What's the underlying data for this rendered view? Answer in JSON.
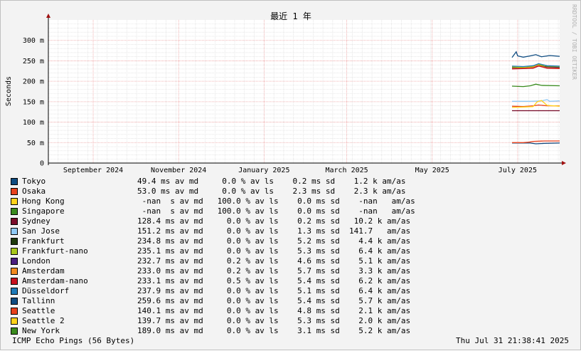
{
  "chart_data": {
    "type": "line",
    "title": "最近 1 年",
    "ylabel": "Seconds",
    "ylim": [
      0,
      0.35
    ],
    "y_ticks": [
      {
        "value": 0,
        "label": "0"
      },
      {
        "value": 0.05,
        "label": "50 m"
      },
      {
        "value": 0.1,
        "label": "100 m"
      },
      {
        "value": 0.15,
        "label": "150 m"
      },
      {
        "value": 0.2,
        "label": "200 m"
      },
      {
        "value": 0.25,
        "label": "250 m"
      },
      {
        "value": 0.3,
        "label": "300 m"
      }
    ],
    "xlim": [
      "2024-07-31",
      "2025-07-31"
    ],
    "x_ticks": [
      {
        "date": "2024-09-01",
        "label": "September 2024"
      },
      {
        "date": "2024-11-01",
        "label": "November 2024"
      },
      {
        "date": "2025-01-01",
        "label": "January 2025"
      },
      {
        "date": "2025-03-01",
        "label": "March 2025"
      },
      {
        "date": "2025-05-01",
        "label": "May 2025"
      },
      {
        "date": "2025-07-01",
        "label": "July 2025"
      }
    ],
    "grid": true,
    "series": [
      {
        "name": "Tokyo",
        "color": "#0f4c81",
        "stats": "49.4 ms av md     0.0 % av ls    0.2 ms sd    1.2 k am/as",
        "points": [
          [
            "2025-06-27",
            0.049
          ],
          [
            "2025-07-05",
            0.049
          ],
          [
            "2025-07-10",
            0.049
          ],
          [
            "2025-07-14",
            0.047
          ],
          [
            "2025-07-20",
            0.048
          ],
          [
            "2025-07-31",
            0.049
          ]
        ]
      },
      {
        "name": "Osaka",
        "color": "#e8411c",
        "stats": "53.0 ms av md     0.0 % av ls    2.3 ms sd    2.3 k am/as",
        "points": [
          [
            "2025-06-27",
            0.05
          ],
          [
            "2025-07-05",
            0.05
          ],
          [
            "2025-07-09",
            0.051
          ],
          [
            "2025-07-12",
            0.053
          ],
          [
            "2025-07-20",
            0.054
          ],
          [
            "2025-07-31",
            0.054
          ]
        ]
      },
      {
        "name": "Hong Kong",
        "color": "#ffd21a",
        "stats": " -nan  s av md   100.0 % av ls    0.0 ms sd    -nan   am/as",
        "points": []
      },
      {
        "name": "Singapore",
        "color": "#3a8b1e",
        "stats": " -nan  s av md   100.0 % av ls    0.0 ms sd    -nan   am/as",
        "points": []
      },
      {
        "name": "Sydney",
        "color": "#7a0c2a",
        "stats": "128.4 ms av md     0.0 % av ls    0.2 ms sd   10.2 k am/as",
        "points": [
          [
            "2025-06-27",
            0.128
          ],
          [
            "2025-07-31",
            0.128
          ]
        ]
      },
      {
        "name": "San Jose",
        "color": "#8fc9f5",
        "stats": "151.2 ms av md     0.0 % av ls    1.3 ms sd  141.7   am/as",
        "points": [
          [
            "2025-06-27",
            0.151
          ],
          [
            "2025-07-10",
            0.151
          ],
          [
            "2025-07-18",
            0.152
          ],
          [
            "2025-07-22",
            0.155
          ],
          [
            "2025-07-24",
            0.151
          ],
          [
            "2025-07-31",
            0.152
          ]
        ]
      },
      {
        "name": "Frankfurt",
        "color": "#1e3a0c",
        "stats": "234.8 ms av md     0.0 % av ls    5.2 ms sd    4.4 k am/as",
        "points": [
          [
            "2025-06-27",
            0.234
          ],
          [
            "2025-07-05",
            0.233
          ],
          [
            "2025-07-12",
            0.235
          ],
          [
            "2025-07-15",
            0.24
          ],
          [
            "2025-07-20",
            0.236
          ],
          [
            "2025-07-31",
            0.235
          ]
        ]
      },
      {
        "name": "Frankfurt-nano",
        "color": "#a8c81a",
        "stats": "235.1 ms av md     0.0 % av ls    5.3 ms sd    6.4 k am/as",
        "points": [
          [
            "2025-06-27",
            0.235
          ],
          [
            "2025-07-05",
            0.234
          ],
          [
            "2025-07-12",
            0.236
          ],
          [
            "2025-07-16",
            0.241
          ],
          [
            "2025-07-22",
            0.237
          ],
          [
            "2025-07-31",
            0.236
          ]
        ]
      },
      {
        "name": "London",
        "color": "#4a1e80",
        "stats": "232.7 ms av md     0.2 % av ls    4.6 ms sd    5.1 k am/as",
        "points": [
          [
            "2025-06-27",
            0.232
          ],
          [
            "2025-07-05",
            0.231
          ],
          [
            "2025-07-12",
            0.233
          ],
          [
            "2025-07-15",
            0.238
          ],
          [
            "2025-07-22",
            0.234
          ],
          [
            "2025-07-31",
            0.233
          ]
        ]
      },
      {
        "name": "Amsterdam",
        "color": "#f28a1e",
        "stats": "233.0 ms av md     0.2 % av ls    5.7 ms sd    3.3 k am/as",
        "points": [
          [
            "2025-06-27",
            0.231
          ],
          [
            "2025-07-05",
            0.232
          ],
          [
            "2025-07-12",
            0.234
          ],
          [
            "2025-07-15",
            0.239
          ],
          [
            "2025-07-22",
            0.233
          ],
          [
            "2025-07-31",
            0.232
          ]
        ]
      },
      {
        "name": "Amsterdam-nano",
        "color": "#c8101e",
        "stats": "233.1 ms av md     0.5 % av ls    5.4 ms sd    6.2 k am/as",
        "points": [
          [
            "2025-06-27",
            0.23
          ],
          [
            "2025-07-05",
            0.231
          ],
          [
            "2025-07-12",
            0.232
          ],
          [
            "2025-07-16",
            0.237
          ],
          [
            "2025-07-22",
            0.232
          ],
          [
            "2025-07-31",
            0.231
          ]
        ]
      },
      {
        "name": "Düsseldorf",
        "color": "#1e7ab8",
        "stats": "237.9 ms av md     0.0 % av ls    5.1 ms sd    6.4 k am/as",
        "points": [
          [
            "2025-06-27",
            0.237
          ],
          [
            "2025-07-05",
            0.236
          ],
          [
            "2025-07-12",
            0.238
          ],
          [
            "2025-07-16",
            0.243
          ],
          [
            "2025-07-22",
            0.238
          ],
          [
            "2025-07-31",
            0.237
          ]
        ]
      },
      {
        "name": "Tallinn",
        "color": "#0f4c81",
        "stats": "259.6 ms av md     0.0 % av ls    5.4 ms sd    5.7 k am/as",
        "points": [
          [
            "2025-06-27",
            0.258
          ],
          [
            "2025-06-30",
            0.272
          ],
          [
            "2025-07-01",
            0.262
          ],
          [
            "2025-07-05",
            0.259
          ],
          [
            "2025-07-10",
            0.262
          ],
          [
            "2025-07-14",
            0.265
          ],
          [
            "2025-07-18",
            0.26
          ],
          [
            "2025-07-24",
            0.263
          ],
          [
            "2025-07-31",
            0.261
          ]
        ]
      },
      {
        "name": "Seattle",
        "color": "#e8411c",
        "stats": "140.1 ms av md     0.0 % av ls    4.8 ms sd    2.1 k am/as",
        "points": [
          [
            "2025-06-27",
            0.139
          ],
          [
            "2025-07-05",
            0.138
          ],
          [
            "2025-07-12",
            0.14
          ],
          [
            "2025-07-16",
            0.142
          ],
          [
            "2025-07-22",
            0.14
          ],
          [
            "2025-07-31",
            0.14
          ]
        ]
      },
      {
        "name": "Seattle 2",
        "color": "#ffd21a",
        "stats": "139.7 ms av md     0.0 % av ls    5.3 ms sd    2.0 k am/as",
        "points": [
          [
            "2025-06-27",
            0.136
          ],
          [
            "2025-07-05",
            0.137
          ],
          [
            "2025-07-12",
            0.138
          ],
          [
            "2025-07-15",
            0.15
          ],
          [
            "2025-07-18",
            0.153
          ],
          [
            "2025-07-22",
            0.141
          ],
          [
            "2025-07-31",
            0.139
          ]
        ]
      },
      {
        "name": "New York",
        "color": "#3a8b1e",
        "stats": "189.0 ms av md     0.0 % av ls    3.1 ms sd    5.2 k am/as",
        "points": [
          [
            "2025-06-27",
            0.188
          ],
          [
            "2025-07-05",
            0.187
          ],
          [
            "2025-07-10",
            0.189
          ],
          [
            "2025-07-14",
            0.193
          ],
          [
            "2025-07-18",
            0.19
          ],
          [
            "2025-07-31",
            0.189
          ]
        ]
      }
    ]
  },
  "watermark": "RRDTOOL / TOBI OETIKER",
  "footer": {
    "description": "ICMP Echo Pings (56 Bytes)",
    "timestamp": "Thu Jul 31 21:38:41 2025"
  },
  "colors": {
    "canvas": "#ffffff",
    "frame_bg": "#f3f3f3",
    "major_grid": "#f0a0a0",
    "minor_grid": "#d8d8d8",
    "axis_arrow": "#a01010"
  }
}
